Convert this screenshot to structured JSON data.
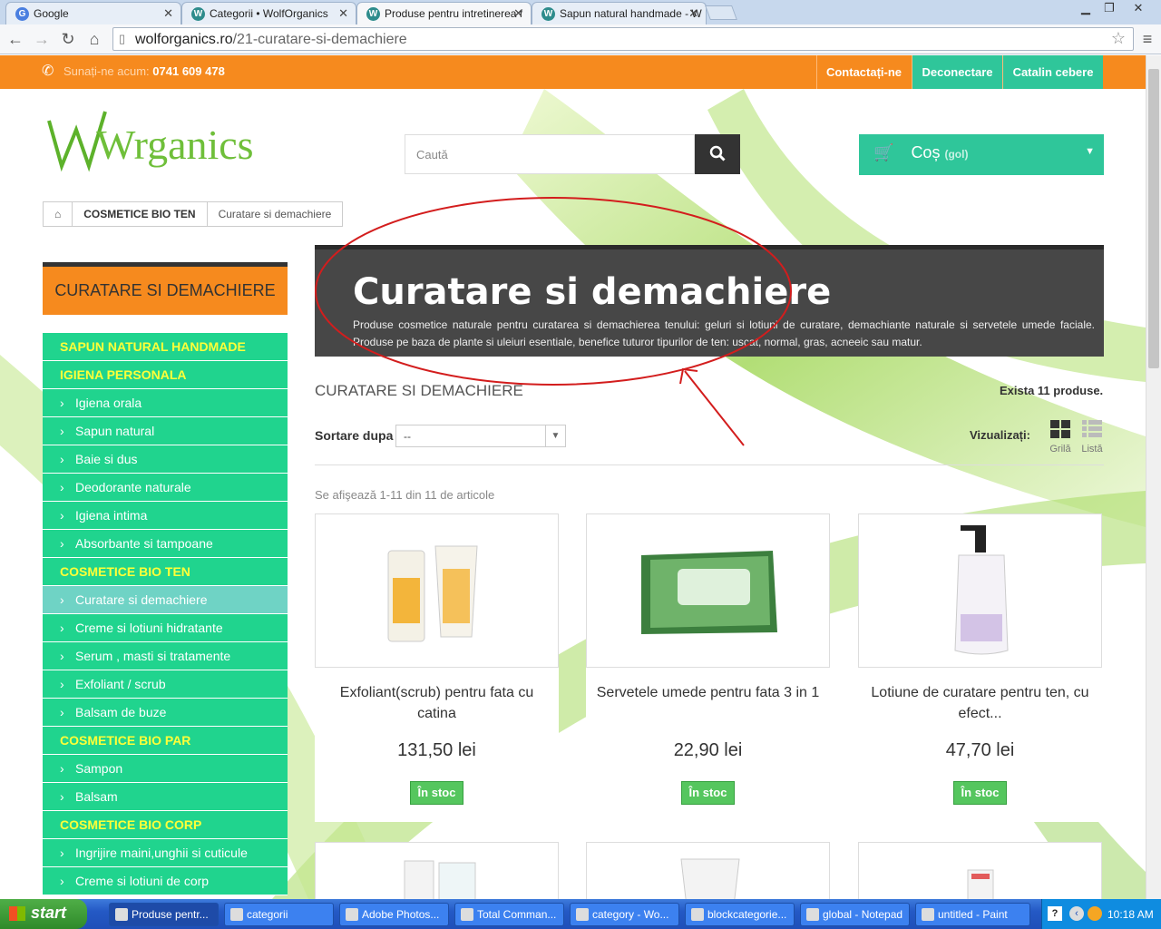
{
  "browser": {
    "tabs": [
      {
        "title": "Google",
        "icon": "G"
      },
      {
        "title": "Categorii • WolfOrganics",
        "icon": "W"
      },
      {
        "title": "Produse pentru intretinerea f",
        "icon": "W"
      },
      {
        "title": "Sapun natural handmade - W",
        "icon": "W"
      }
    ],
    "url_host": "wolforganics.ro",
    "url_path": "/21-curatare-si-demachiere"
  },
  "topbar": {
    "phone_label": "Sunați-ne acum:",
    "phone_number": "0741 609 478",
    "links": [
      "Contactați-ne",
      "Deconectare",
      "Catalin cebere"
    ]
  },
  "header": {
    "logo_text": "Wrganics",
    "search_placeholder": "Caută",
    "cart_label": "Coș",
    "cart_status": "(gol)"
  },
  "breadcrumb": {
    "category": "COSMETICE BIO TEN",
    "current": "Curatare si demachiere"
  },
  "sidebar": {
    "title": "CURATARE SI DEMACHIERE",
    "items": [
      {
        "label": "SAPUN NATURAL HANDMADE",
        "type": "cat"
      },
      {
        "label": "IGIENA PERSONALA",
        "type": "cat"
      },
      {
        "label": "Igiena orala",
        "type": "sub"
      },
      {
        "label": "Sapun natural",
        "type": "sub"
      },
      {
        "label": "Baie si dus",
        "type": "sub"
      },
      {
        "label": "Deodorante naturale",
        "type": "sub"
      },
      {
        "label": "Igiena intima",
        "type": "sub"
      },
      {
        "label": "Absorbante si tampoane",
        "type": "sub"
      },
      {
        "label": "COSMETICE BIO TEN",
        "type": "cat"
      },
      {
        "label": "Curatare si demachiere",
        "type": "sel"
      },
      {
        "label": "Creme si lotiuni hidratante",
        "type": "sub"
      },
      {
        "label": "Serum , masti si tratamente",
        "type": "sub"
      },
      {
        "label": "Exfoliant / scrub",
        "type": "sub"
      },
      {
        "label": "Balsam de buze",
        "type": "sub"
      },
      {
        "label": "COSMETICE BIO PAR",
        "type": "cat"
      },
      {
        "label": "Sampon",
        "type": "sub"
      },
      {
        "label": "Balsam",
        "type": "sub"
      },
      {
        "label": "COSMETICE BIO CORP",
        "type": "cat"
      },
      {
        "label": "Ingrijire maini,unghii si cuticule",
        "type": "sub"
      },
      {
        "label": "Creme si lotiuni de corp",
        "type": "sub"
      }
    ]
  },
  "category": {
    "title": "Curatare si demachiere",
    "description": "Produse cosmetice naturale pentru curatarea si demachierea tenului: geluri si lotiuni de curatare, demachiante naturale si servetele umede faciale. Produse pe baza de plante si uleiuri esentiale, benefice tuturor tipurilor de ten: uscat, normal, gras, acneeic sau matur.",
    "subtitle": "CURATARE SI DEMACHIERE",
    "count": "Exista 11 produse.",
    "sort_label": "Sortare dupa",
    "sort_value": "--",
    "view_label": "Vizualizați:",
    "view_grid": "Grilă",
    "view_list": "Listă",
    "showing": "Se afişează 1-11 din 11 de articole"
  },
  "products": [
    {
      "name": "Exfoliant(scrub) pentru fata cu catina",
      "price": "131,50 lei",
      "stock": "În stoc"
    },
    {
      "name": "Servetele umede pentru fata 3 in 1",
      "price": "22,90 lei",
      "stock": "În stoc"
    },
    {
      "name": "Lotiune de curatare pentru ten, cu efect...",
      "price": "47,70 lei",
      "stock": "În stoc"
    }
  ],
  "taskbar": {
    "start": "start",
    "tasks": [
      "Produse pentr...",
      "categorii",
      "Adobe Photos...",
      "Total Comman...",
      "category - Wo...",
      "blockcategorie...",
      "global - Notepad",
      "untitled - Paint"
    ],
    "clock": "10:18 AM"
  }
}
